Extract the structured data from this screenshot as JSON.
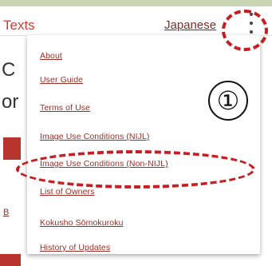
{
  "app": {
    "title": "Texts",
    "language": "Japanese"
  },
  "menu": {
    "items": [
      {
        "label": "About"
      },
      {
        "label": "User Guide"
      },
      {
        "label": "Terms of Use"
      },
      {
        "label": "Image Use Conditions (NIJL)"
      },
      {
        "label": "Image Use Conditions (Non-NIJL)"
      },
      {
        "label": "List of Owners"
      },
      {
        "label": "Kokusho Sōmokuroku"
      },
      {
        "label": "History of Updates"
      }
    ]
  },
  "background": {
    "fragment_1": "C",
    "fragment_2": "or",
    "fragment_3": "B"
  },
  "annotation": {
    "step_number": "①"
  },
  "colors": {
    "accent": "#c2433b",
    "link": "#9a2e26",
    "annotation": "#c51f24"
  },
  "icons": {
    "overflow_menu": "kebab-menu-icon"
  }
}
